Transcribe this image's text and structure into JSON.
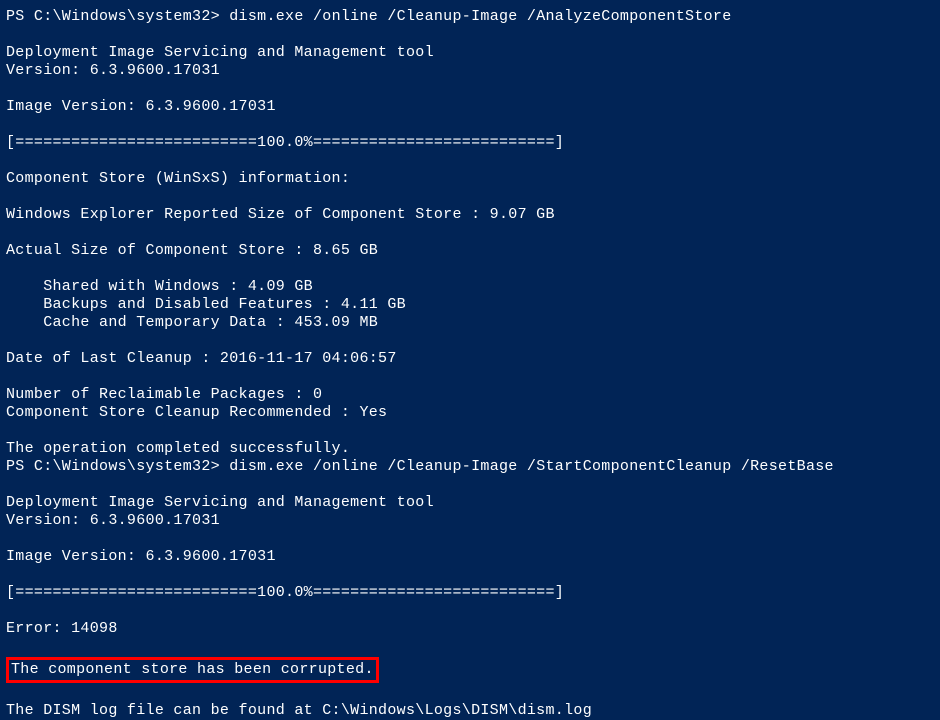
{
  "session1": {
    "prompt": "PS C:\\Windows\\system32>",
    "command": "dism.exe /online /Cleanup-Image /AnalyzeComponentStore",
    "header": "Deployment Image Servicing and Management tool",
    "version": "Version: 6.3.9600.17031",
    "imageVersion": "Image Version: 6.3.9600.17031",
    "progress": "[==========================100.0%==========================]",
    "storeInfoHeader": "Component Store (WinSxS) information:",
    "reportedSize": "Windows Explorer Reported Size of Component Store : 9.07 GB",
    "actualSize": "Actual Size of Component Store : 8.65 GB",
    "sharedWindows": "    Shared with Windows : 4.09 GB",
    "backups": "    Backups and Disabled Features : 4.11 GB",
    "cache": "    Cache and Temporary Data : 453.09 MB",
    "lastCleanup": "Date of Last Cleanup : 2016-11-17 04:06:57",
    "reclaimable": "Number of Reclaimable Packages : 0",
    "recommended": "Component Store Cleanup Recommended : Yes",
    "success": "The operation completed successfully."
  },
  "session2": {
    "prompt": "PS C:\\Windows\\system32>",
    "command": "dism.exe /online /Cleanup-Image /StartComponentCleanup /ResetBase",
    "header": "Deployment Image Servicing and Management tool",
    "version": "Version: 6.3.9600.17031",
    "imageVersion": "Image Version: 6.3.9600.17031",
    "progress": "[==========================100.0%==========================]",
    "error": "Error: 14098",
    "errorMessage": "The component store has been corrupted.",
    "logFile": "The DISM log file can be found at C:\\Windows\\Logs\\DISM\\dism.log"
  }
}
